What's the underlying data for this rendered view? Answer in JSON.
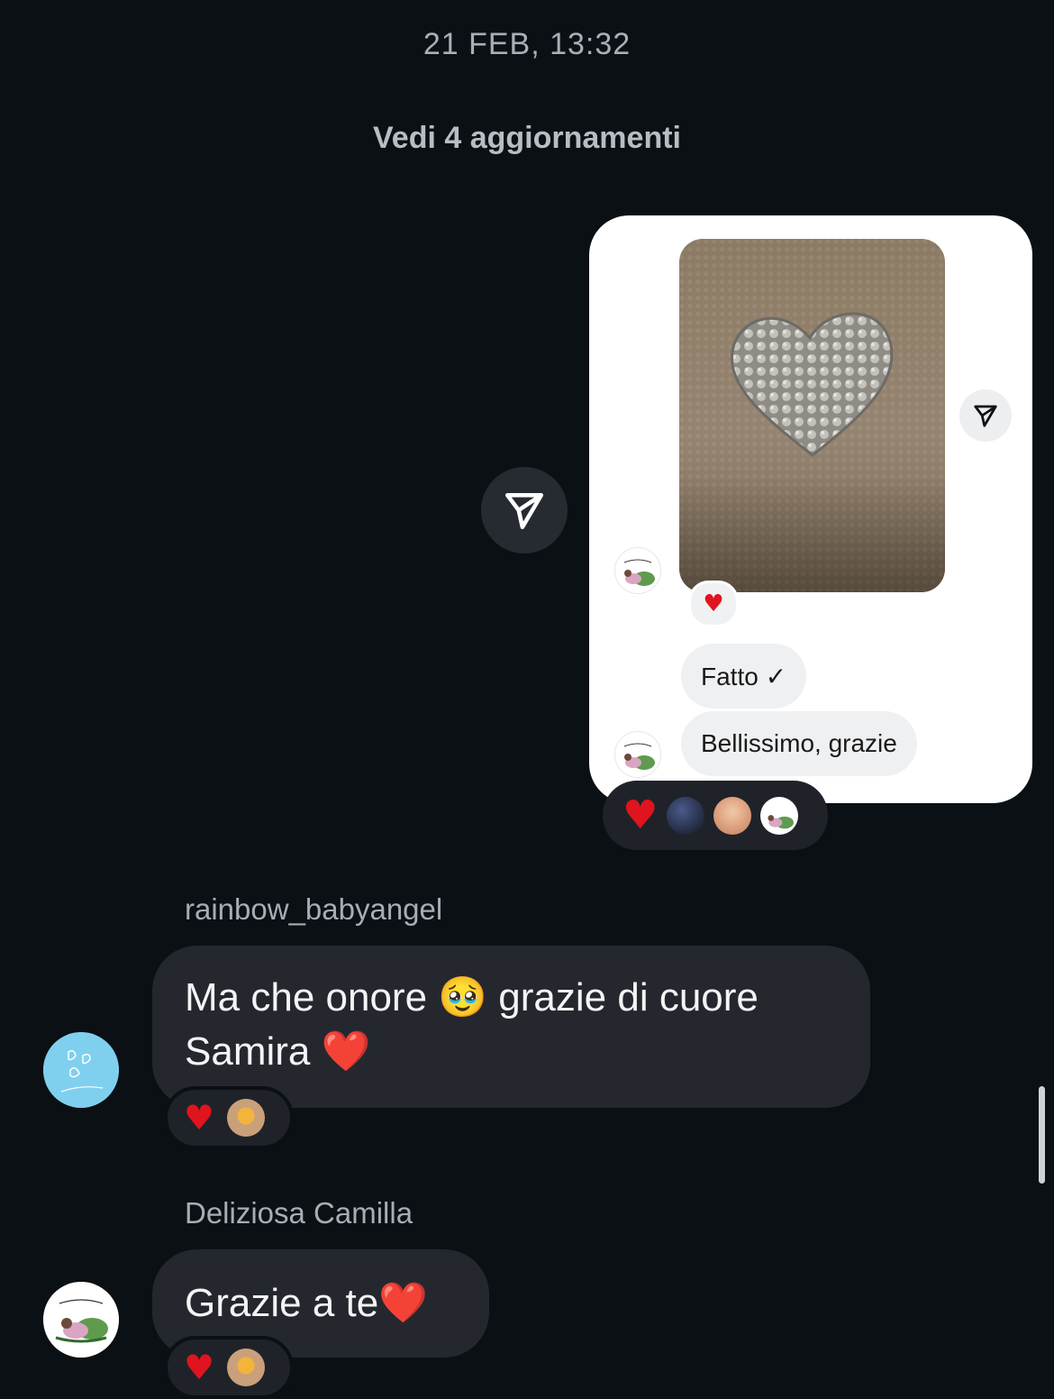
{
  "header": {
    "timestamp": "21 FEB, 13:32",
    "updates_link": "Vedi 4 aggiornamenti"
  },
  "shared_post": {
    "messages": [
      {
        "text": "Fatto ✓"
      },
      {
        "text": "Bellissimo, grazie"
      }
    ],
    "avatar_label": "Deliziosa Camilla",
    "reactions": {
      "emoji": "❤️"
    }
  },
  "thread": [
    {
      "username": "rainbow_babyangel",
      "avatar_label": "RBA",
      "line1": "Ma che onore 🥹 grazie di cuore",
      "line2": "Samira ❤️",
      "reaction": "❤️"
    },
    {
      "username": "Deliziosa Camilla",
      "avatar_label": "Deliziosa Camilla",
      "text": "Grazie a te❤️",
      "reaction": "❤️"
    }
  ],
  "colors": {
    "background": "#0b1014",
    "bubble": "#24282e",
    "heart": "#e0141e"
  }
}
